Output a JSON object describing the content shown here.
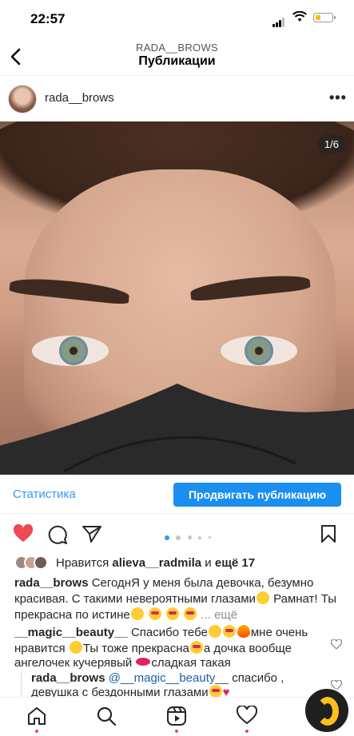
{
  "status_bar": {
    "time": "22:57"
  },
  "nav": {
    "account": "RADA__BROWS",
    "title": "Публикации"
  },
  "post": {
    "username": "rada__brows",
    "photo_counter": "1/6",
    "current_slide": 1,
    "total_slides": 6
  },
  "actions": {
    "statistics": "Статистика",
    "promote": "Продвигать публикацию"
  },
  "likes": {
    "prefix": "Нравится",
    "user": "alieva__radmila",
    "and": "и",
    "others": "ещё 17"
  },
  "caption": {
    "user": "rada__brows",
    "text1": "СегоднЯ у меня была девочка, безумно красивая. С такими невероятными глазами",
    "text2": "Рамнат! Ты прекрасна по истине",
    "more": "... ещё"
  },
  "comment": {
    "user": "__magic__beauty__",
    "text1": "Спасибо тебе",
    "text2": "мне очень нравится",
    "text3": "Ты тоже прекрасна",
    "text4": "а дочка вообще ангелочек кучерявый",
    "text5": "сладкая такая"
  },
  "reply": {
    "user": "rada__brows",
    "mention": "@__magic__beauty__",
    "text1": "спасибо ,",
    "text2": "девушка с бездонными глазами"
  },
  "colors": {
    "accent_blue": "#1b8ff0",
    "link_blue": "#3897f0",
    "like_red": "#ed4956"
  },
  "icons": [
    "back-chevron-icon",
    "more-dots-icon",
    "heart-filled-icon",
    "comment-icon",
    "share-icon",
    "save-icon",
    "home-icon",
    "search-icon",
    "reels-icon",
    "activity-icon",
    "profile-icon"
  ]
}
